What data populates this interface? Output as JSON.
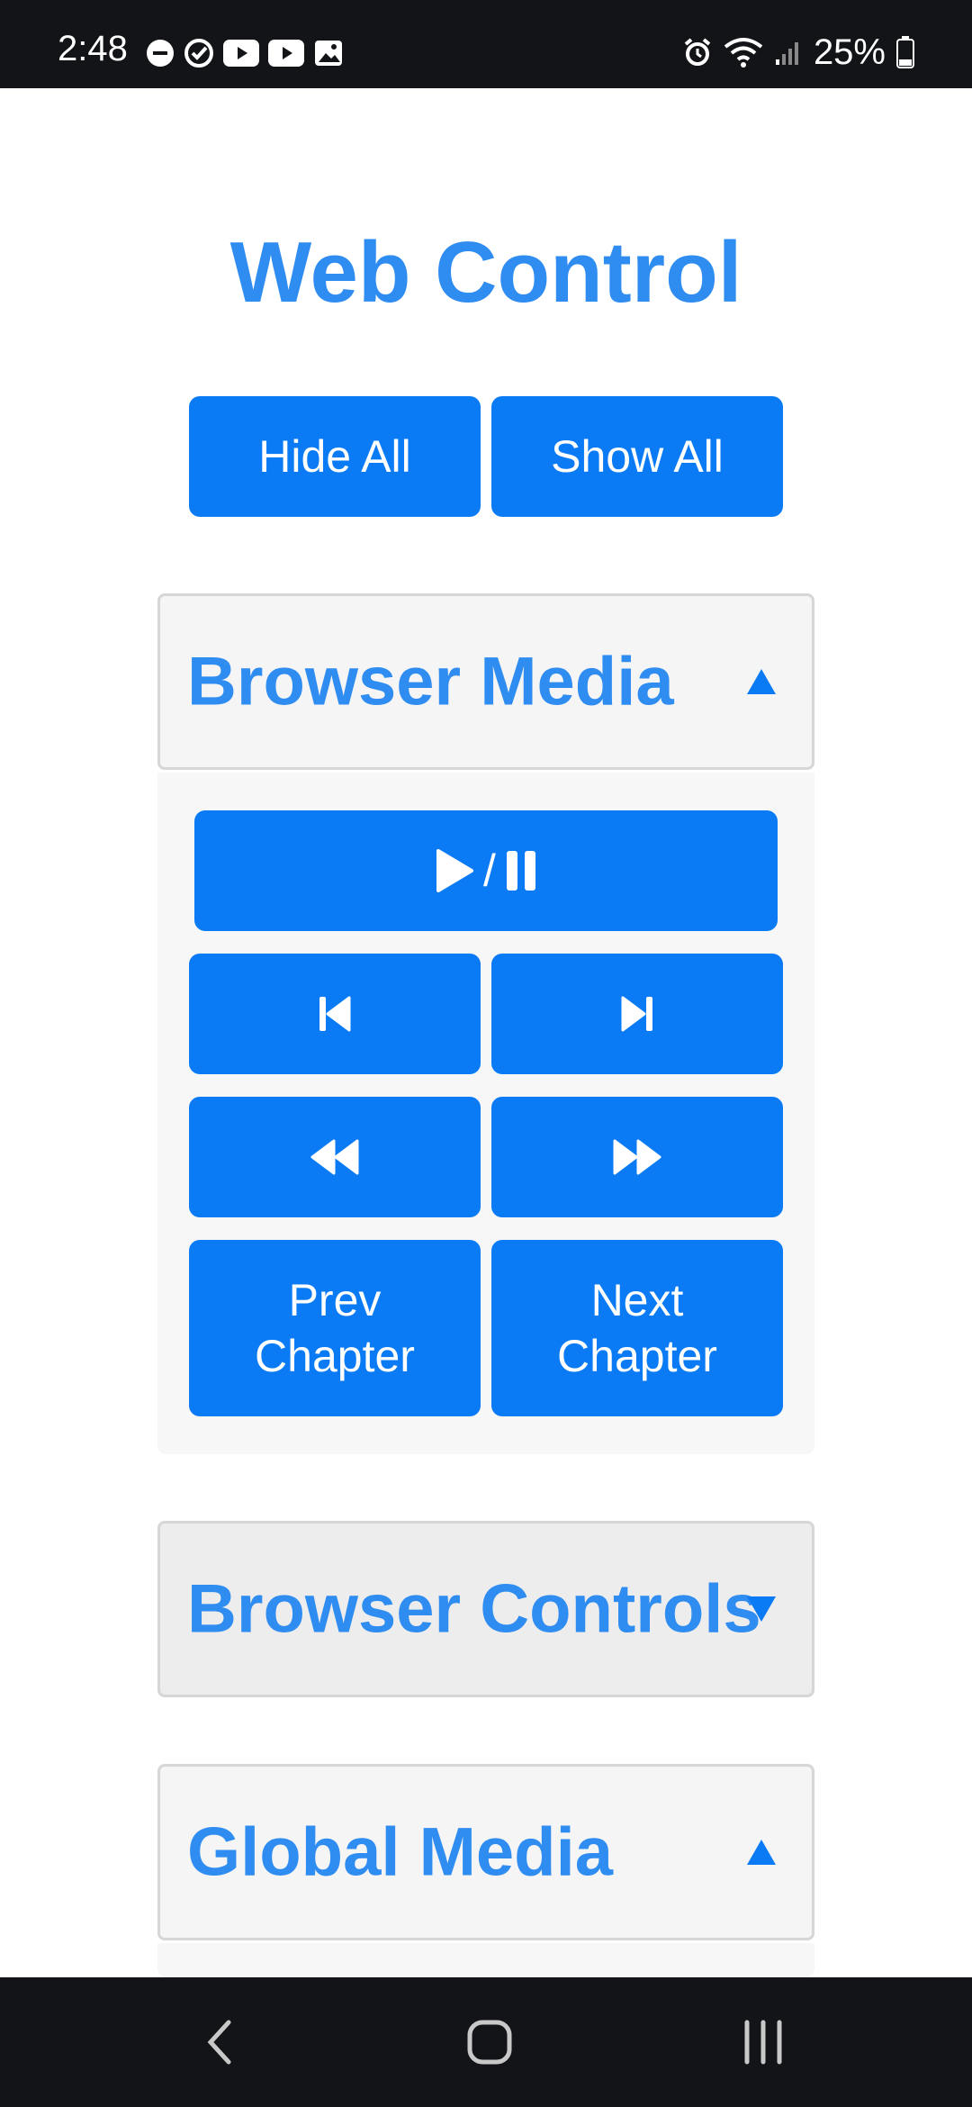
{
  "status_bar": {
    "time": "2:48",
    "battery": "25%",
    "left_icons": [
      "do-not-disturb-icon",
      "check-circle-icon",
      "youtube-icon",
      "youtube-icon",
      "gallery-icon"
    ],
    "right_icons": [
      "alarm-icon",
      "wifi-icon",
      "signal-icon",
      "battery-icon"
    ]
  },
  "page": {
    "title": "Web Control",
    "hide_all_label": "Hide All",
    "show_all_label": "Show All"
  },
  "sections": {
    "browser_media": {
      "title": "Browser Media",
      "state": "expanded",
      "play_pause_separator": "/",
      "prev_chapter": "Prev\nChapter",
      "next_chapter": "Next\nChapter"
    },
    "browser_controls": {
      "title": "Browser Controls",
      "state": "collapsed"
    },
    "global_media": {
      "title": "Global Media",
      "state": "expanded"
    }
  },
  "nav_bar": {
    "items": [
      "back-icon",
      "home-icon",
      "recents-icon"
    ]
  },
  "colors": {
    "accent": "#0a7bf5",
    "title": "#2f8cf0",
    "system_bar": "#131418"
  }
}
